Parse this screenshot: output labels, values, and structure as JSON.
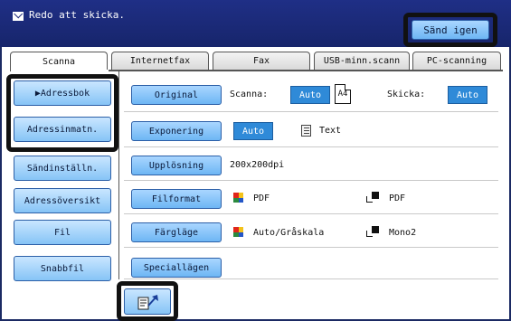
{
  "status": {
    "message": "Redo att skicka.",
    "message_icon": "envelope-icon"
  },
  "header": {
    "resend_label": "Sänd igen"
  },
  "tabs": [
    {
      "label": "Scanna",
      "active": true
    },
    {
      "label": "Internetfax",
      "active": false
    },
    {
      "label": "Fax",
      "active": false
    },
    {
      "label": "USB-minn.scann",
      "active": false
    },
    {
      "label": "PC-scanning",
      "active": false
    }
  ],
  "sidebar": {
    "items": [
      {
        "label": "▶Adressbok"
      },
      {
        "label": "Adressinmatn."
      },
      {
        "label": "Sändinställn."
      },
      {
        "label": "Adressöversikt"
      },
      {
        "label": "Fil"
      },
      {
        "label": "Snabbfil"
      }
    ]
  },
  "settings": {
    "original": {
      "button_label": "Original",
      "scan_label": "Scanna:",
      "scan_value": "Auto",
      "scan_size": "A4",
      "send_label": "Skicka:",
      "send_value": "Auto"
    },
    "exposure": {
      "button_label": "Exponering",
      "value": "Auto",
      "mode_label": "Text",
      "mode_icon": "text-document-icon"
    },
    "resolution": {
      "button_label": "Upplösning",
      "value": "200x200dpi"
    },
    "file_format": {
      "button_label": "Filformat",
      "color_value": "PDF",
      "mono_value": "PDF"
    },
    "color_mode": {
      "button_label": "Färgläge",
      "color_value": "Auto/Gråskala",
      "mono_value": "Mono2"
    },
    "special": {
      "button_label": "Speciallägen"
    }
  },
  "footer": {
    "action_icon": "scan-to-send-icon"
  },
  "colors": {
    "title_bar": "#1d2b7a",
    "button_blue": "#86c4f6",
    "selected_value": "#2f8ad8",
    "highlight_outline": "#111111"
  }
}
